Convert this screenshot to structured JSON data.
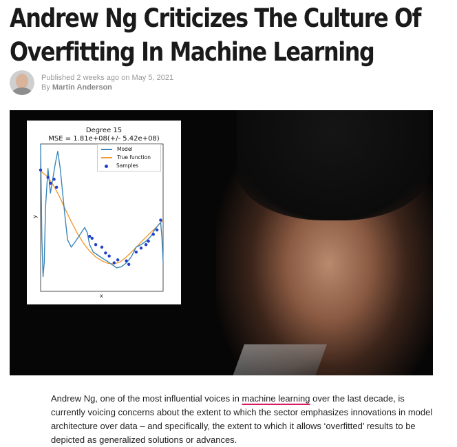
{
  "article": {
    "headline_line1": "Andrew Ng Criticizes The Culture Of",
    "headline_line2": "Overfitting In Machine Learning",
    "published_label": "Published",
    "published_relative": "2 weeks ago",
    "published_on": "on",
    "published_date": "May 5, 2021",
    "by_label": "By",
    "author": "Martin Anderson",
    "body_before_link": "Andrew Ng, one of the most influential voices in ",
    "body_link": "machine learning",
    "body_after_link": " over the last decade, is currently voicing concerns about the extent to which the sector emphasizes innovations in model architecture over data – and specifically, the extent to which it allows ‘overfitted’ results to be depicted as generalized solutions or advances."
  },
  "colors": {
    "link_underline": "#d81b60",
    "model_line": "#3a86b8",
    "true_function_line": "#f39c33",
    "samples_dots": "#1f3fd1"
  },
  "icons": {
    "author_avatar": "avatar"
  },
  "figure": {
    "title_line1": "Degree 15",
    "title_line2": "MSE = 1.81e+08(+/- 5.42e+08)",
    "xlabel": "x",
    "ylabel": "y",
    "legend": [
      "Model",
      "True function",
      "Samples"
    ],
    "chart_data": {
      "type": "line",
      "title": "Degree 15",
      "subtitle": "MSE = 1.81e+08(+/- 5.42e+08)",
      "xlabel": "x",
      "ylabel": "y",
      "xlim": [
        0,
        1
      ],
      "ylim": [
        -1.5,
        1.5
      ],
      "legend_placement": "top-right",
      "series": [
        {
          "name": "Model",
          "color": "#3a86b8",
          "x": [
            0.0,
            0.01,
            0.02,
            0.03,
            0.04,
            0.06,
            0.08,
            0.1,
            0.12,
            0.14,
            0.16,
            0.18,
            0.2,
            0.22,
            0.25,
            0.28,
            0.32,
            0.36,
            0.38,
            0.4,
            0.43,
            0.46,
            0.5,
            0.54,
            0.58,
            0.62,
            0.66,
            0.7,
            0.74,
            0.78,
            0.82,
            0.86,
            0.9,
            0.93,
            0.96,
            0.98,
            0.99,
            1.0
          ],
          "y": [
            1.6,
            -0.4,
            -1.2,
            -0.9,
            0.2,
            1.0,
            0.5,
            0.8,
            1.1,
            1.35,
            1.0,
            0.5,
            0.0,
            -0.45,
            -0.6,
            -0.5,
            -0.35,
            -0.2,
            -0.3,
            -0.55,
            -0.7,
            -0.75,
            -0.82,
            -0.88,
            -0.95,
            -1.02,
            -1.0,
            -0.92,
            -0.8,
            -0.6,
            -0.55,
            -0.48,
            -0.38,
            -0.25,
            -0.15,
            -0.1,
            -0.4,
            -0.9
          ]
        },
        {
          "name": "True function",
          "color": "#f39c33",
          "x": [
            0.0,
            0.05,
            0.1,
            0.15,
            0.2,
            0.25,
            0.3,
            0.35,
            0.4,
            0.45,
            0.5,
            0.55,
            0.6,
            0.65,
            0.7,
            0.75,
            0.8,
            0.85,
            0.9,
            0.95,
            1.0
          ],
          "y": [
            0.95,
            0.85,
            0.68,
            0.45,
            0.18,
            -0.08,
            -0.32,
            -0.52,
            -0.68,
            -0.8,
            -0.88,
            -0.93,
            -0.94,
            -0.9,
            -0.8,
            -0.68,
            -0.55,
            -0.42,
            -0.3,
            -0.18,
            -0.05
          ]
        },
        {
          "name": "Samples",
          "color": "#1f3fd1",
          "x": [
            0.0,
            0.06,
            0.08,
            0.11,
            0.13,
            0.4,
            0.42,
            0.45,
            0.5,
            0.53,
            0.56,
            0.6,
            0.63,
            0.7,
            0.72,
            0.78,
            0.82,
            0.86,
            0.88,
            0.92,
            0.95,
            0.98
          ],
          "y": [
            0.97,
            0.82,
            0.7,
            0.78,
            0.62,
            -0.38,
            -0.42,
            -0.55,
            -0.6,
            -0.72,
            -0.78,
            -0.92,
            -0.86,
            -0.88,
            -0.95,
            -0.7,
            -0.62,
            -0.55,
            -0.48,
            -0.34,
            -0.25,
            -0.05
          ]
        }
      ]
    }
  }
}
